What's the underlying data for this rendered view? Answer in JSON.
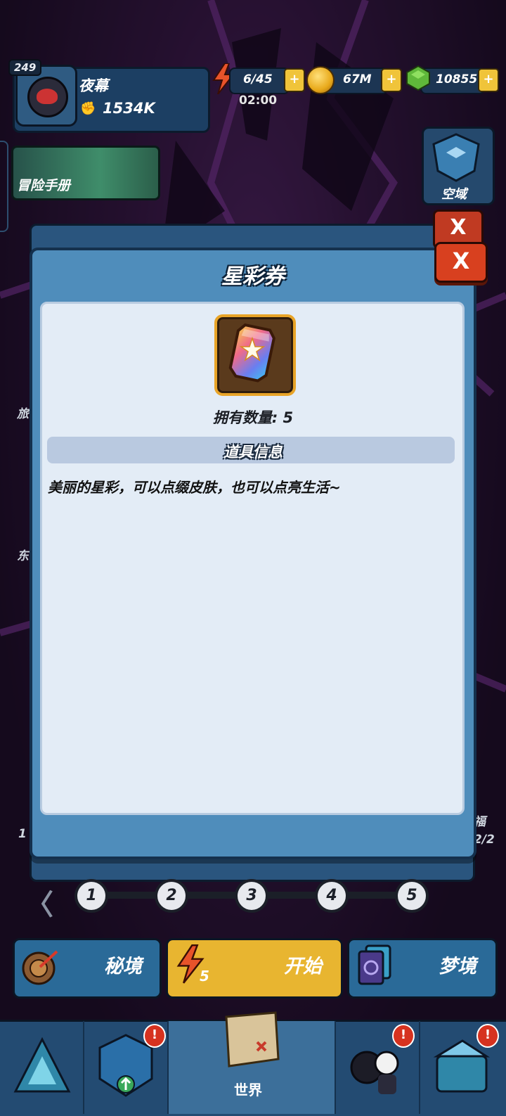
{
  "player": {
    "level": "249",
    "name": "夜幕",
    "power": "1534K"
  },
  "resources": {
    "energy": "6/45",
    "energy_timer": "02:00",
    "coins": "67M",
    "gems": "10855",
    "plus": "+"
  },
  "left_menu": {
    "adventure_manual": "冒险手册"
  },
  "right_menu": {
    "sky_domain": "空域"
  },
  "background": {
    "close_label": "X",
    "side_label_1": "旅",
    "side_label_2": "东",
    "side_label_3": "福",
    "side_label_4": "2/2",
    "side_label_5": "1"
  },
  "pager": {
    "prev": "〈",
    "pages": [
      "1",
      "2",
      "3",
      "4",
      "5"
    ]
  },
  "modes": {
    "secret": "秘境",
    "start": "开始",
    "start_cost": "5",
    "dream": "梦境"
  },
  "nav": {
    "world": "世界",
    "alert": "!"
  },
  "modal": {
    "title": "星彩券",
    "close_label": "X",
    "owned_label": "拥有数量: 5",
    "info_header": "道具信息",
    "description": "美丽的星彩，可以点缀皮肤，也可以点亮生活~"
  }
}
